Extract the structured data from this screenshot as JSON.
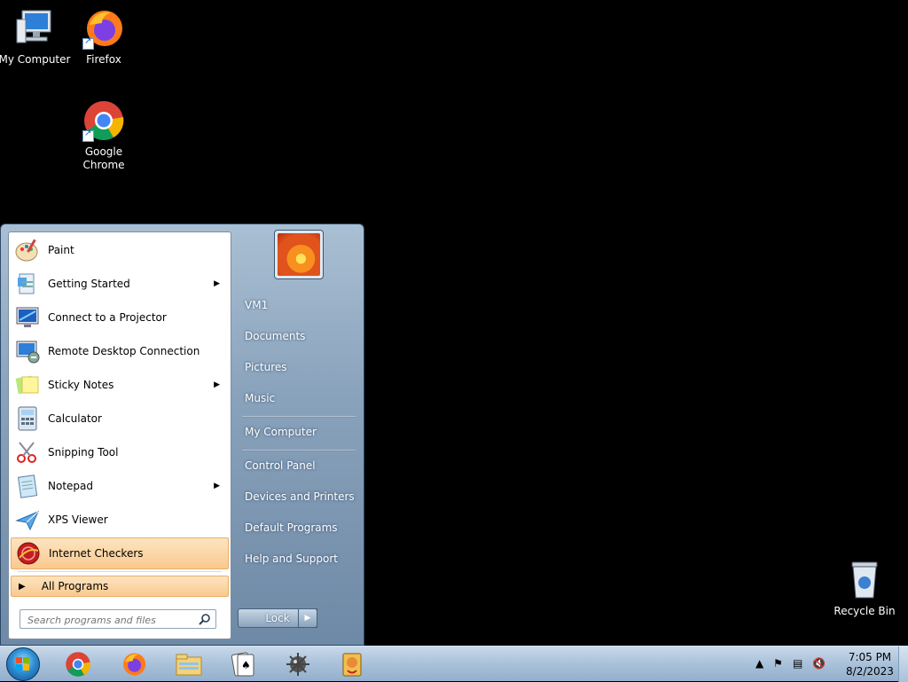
{
  "desktop": {
    "icons": [
      {
        "label": "My Computer",
        "icon": "computer-icon"
      },
      {
        "label": "Firefox",
        "icon": "firefox-icon"
      },
      {
        "label": "Google\nChrome",
        "icon": "chrome-icon"
      },
      {
        "label": "Recycle Bin",
        "icon": "recycle-bin-icon"
      }
    ]
  },
  "start_menu": {
    "programs": [
      {
        "label": "Paint",
        "icon": "paint-icon",
        "submenu": false
      },
      {
        "label": "Getting Started",
        "icon": "getting-started-icon",
        "submenu": true
      },
      {
        "label": "Connect to a Projector",
        "icon": "projector-icon",
        "submenu": false
      },
      {
        "label": "Remote Desktop Connection",
        "icon": "remote-desktop-icon",
        "submenu": false
      },
      {
        "label": "Sticky Notes",
        "icon": "sticky-notes-icon",
        "submenu": true
      },
      {
        "label": "Calculator",
        "icon": "calculator-icon",
        "submenu": false
      },
      {
        "label": "Snipping Tool",
        "icon": "snipping-tool-icon",
        "submenu": false
      },
      {
        "label": "Notepad",
        "icon": "notepad-icon",
        "submenu": true
      },
      {
        "label": "XPS Viewer",
        "icon": "xps-viewer-icon",
        "submenu": false
      },
      {
        "label": "Internet Checkers",
        "icon": "internet-checkers-icon",
        "submenu": false,
        "highlighted": true
      }
    ],
    "all_programs": "All Programs",
    "search_placeholder": "Search programs and files",
    "right_links": {
      "user": "VM1",
      "documents": "Documents",
      "pictures": "Pictures",
      "music": "Music",
      "computer": "My Computer",
      "control_panel": "Control Panel",
      "devices": "Devices and Printers",
      "default_programs": "Default Programs",
      "help": "Help and Support"
    },
    "lock_label": "Lock"
  },
  "taskbar": {
    "pinned": [
      "chrome-icon",
      "firefox-icon",
      "explorer-icon",
      "solitaire-icon",
      "minesweeper-icon",
      "hearts-icon"
    ],
    "clock": {
      "time": "7:05 PM",
      "date": "8/2/2023"
    }
  },
  "colors": {
    "desktop": "#000000",
    "highlight": "#f9c98e",
    "taskbar": "#a9c1d9"
  }
}
